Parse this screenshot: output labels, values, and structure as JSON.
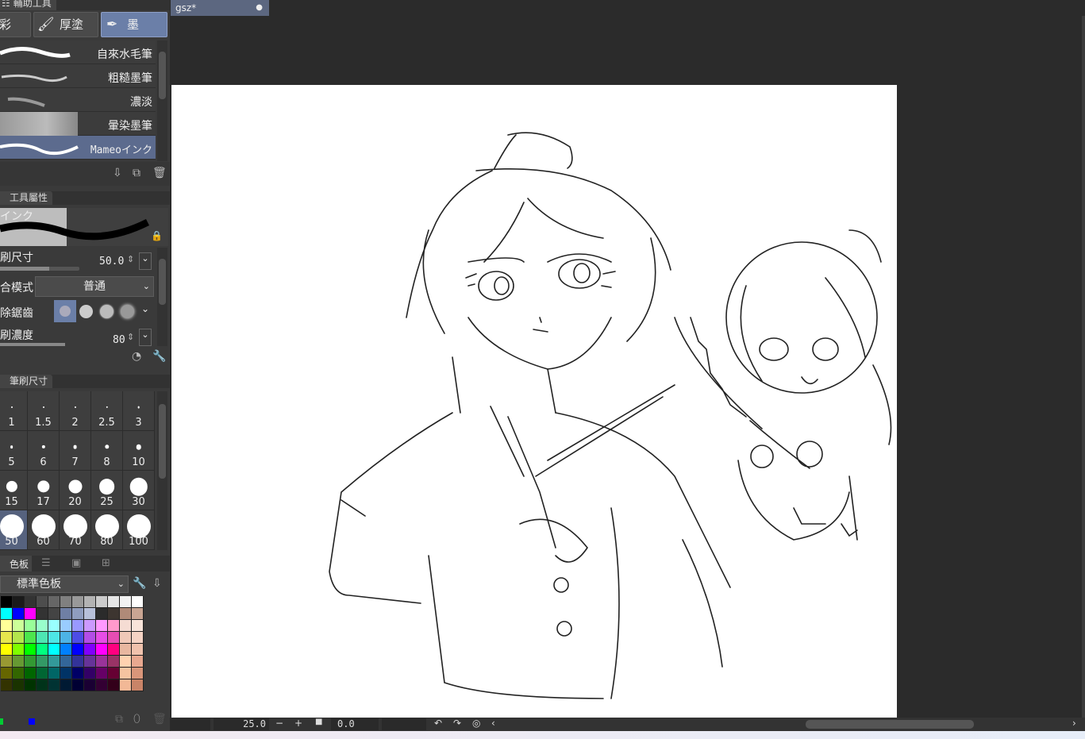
{
  "subtool": {
    "title": "輔助工具",
    "tabs": [
      {
        "label": "彩"
      },
      {
        "label": "厚塗"
      },
      {
        "label": "墨"
      }
    ],
    "brushes": [
      {
        "label": "自來水毛筆"
      },
      {
        "label": "粗糙墨筆"
      },
      {
        "label": "濃淡"
      },
      {
        "label": "暈染墨筆"
      },
      {
        "label": "Mameoインク"
      }
    ]
  },
  "tool_property": {
    "title": "工具屬性",
    "preview_label": "インク",
    "brush_size_label": "刷尺寸",
    "brush_size_value": "50.0",
    "blend_mode_label": "合模式",
    "blend_mode_value": "普通",
    "antialias_label": "除鋸齒",
    "density_label": "刷濃度",
    "density_value": "80"
  },
  "brush_size_palette": {
    "title": "筆刷尺寸",
    "sizes": [
      "1",
      "1.5",
      "2",
      "2.5",
      "3",
      "5",
      "6",
      "7",
      "8",
      "10",
      "15",
      "17",
      "20",
      "25",
      "30",
      "50",
      "60",
      "70",
      "80",
      "100"
    ],
    "selected": "50"
  },
  "color_set": {
    "title": "色板",
    "set_name": "標準色板",
    "colors": [
      [
        "#000000",
        "#1a1a1a",
        "#333333",
        "#4d4d4d",
        "#666666",
        "#808080",
        "#999999",
        "#b3b3b3",
        "#cccccc",
        "#e6e6e6",
        "#f2f2f2",
        "#ffffff"
      ],
      [
        "#00ffff",
        "#0000ff",
        "#ff00ff",
        "#333333",
        "#444444",
        "#6f7fa5",
        "#8f9dbf",
        "#b7c0d9",
        "#2b2b2b",
        "#3d3530",
        "#b08a78",
        "#c9a593"
      ],
      [
        "#ffff99",
        "#ccff99",
        "#99ff99",
        "#99ffcc",
        "#99ffff",
        "#99ccff",
        "#9999ff",
        "#cc99ff",
        "#ff99ff",
        "#ff99cc",
        "#f5dcd3",
        "#f8e4da"
      ],
      [
        "#e6e64d",
        "#b3e64d",
        "#4de64d",
        "#4de6b3",
        "#4de6e6",
        "#4db3e6",
        "#4d4de6",
        "#b34de6",
        "#e64de6",
        "#e64db3",
        "#f0c8b8",
        "#f5d3c4"
      ],
      [
        "#ffff00",
        "#80ff00",
        "#00ff00",
        "#00ff80",
        "#00ffff",
        "#0080ff",
        "#0000ff",
        "#8000ff",
        "#ff00ff",
        "#ff0080",
        "#e8b7a0",
        "#f0c2ad"
      ],
      [
        "#999933",
        "#669933",
        "#339933",
        "#339966",
        "#339999",
        "#336699",
        "#333399",
        "#663399",
        "#993399",
        "#993366",
        "#ffd2b0",
        "#e8a890"
      ],
      [
        "#666600",
        "#336600",
        "#006600",
        "#006633",
        "#006666",
        "#003366",
        "#000066",
        "#330066",
        "#660066",
        "#660033",
        "#f5c3a0",
        "#d9967a"
      ],
      [
        "#333300",
        "#1a3300",
        "#003300",
        "#00331a",
        "#003333",
        "#001a33",
        "#000033",
        "#1a0033",
        "#330033",
        "#33001a",
        "#f2b896",
        "#c98468"
      ]
    ],
    "main_color": "#00cc33",
    "sub_color": "#0000ff"
  },
  "document": {
    "tab_title": "gsz*"
  },
  "status": {
    "zoom": "25.0",
    "angle": "0.0"
  }
}
